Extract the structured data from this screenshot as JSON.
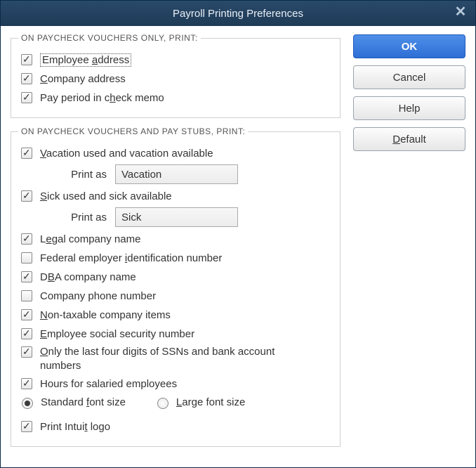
{
  "title": "Payroll Printing Preferences",
  "group1": {
    "legend": "ON PAYCHECK VOUCHERS ONLY, PRINT:",
    "emp_addr": {
      "label_pre": "Employee ",
      "u": "a",
      "label_post": "ddress",
      "checked": true
    },
    "comp_addr": {
      "u": "C",
      "label_post": "ompany address",
      "checked": true
    },
    "payperiod": {
      "label_pre": "Pay period in c",
      "u": "h",
      "label_post": "eck memo",
      "checked": true
    }
  },
  "group2": {
    "legend": "ON PAYCHECK VOUCHERS AND PAY STUBS, PRINT:",
    "vacation": {
      "u": "V",
      "label_post": "acation used and vacation available",
      "checked": true
    },
    "vac_printas": "Print as",
    "vac_value": "Vacation",
    "sick": {
      "u": "S",
      "label_post": "ick used and sick available",
      "checked": true
    },
    "sick_printas": "Print as",
    "sick_value": "Sick",
    "legal": {
      "label_pre": "L",
      "u": "e",
      "label_post": "gal company name",
      "checked": true
    },
    "fein": {
      "label_pre": "Federal employer ",
      "u": "i",
      "label_post": "dentification number",
      "checked": false
    },
    "dba": {
      "label_pre": "D",
      "u": "B",
      "label_post": "A company name",
      "checked": true
    },
    "phone": {
      "label_pre": "Company phone number",
      "checked": false,
      "no_u": true
    },
    "nontax": {
      "u": "N",
      "label_post": "on-taxable company items",
      "checked": true
    },
    "ssn": {
      "u": "E",
      "label_post": "mployee social security number",
      "checked": true
    },
    "last4": {
      "u": "O",
      "label_post": "nly the last four digits of SSNs and bank account numbers",
      "checked": true
    },
    "hours": {
      "label_pre": "Hours for salaried employees",
      "checked": true,
      "no_u": true
    },
    "font_std": {
      "label_pre": "Standard ",
      "u": "f",
      "label_post": "ont size",
      "checked": true
    },
    "font_lg": {
      "u": "L",
      "label_post": "arge font size",
      "checked": false
    },
    "logo": {
      "label_pre": "Print Intui",
      "u": "t",
      "label_post": " logo",
      "checked": true
    }
  },
  "buttons": {
    "ok": "OK",
    "cancel": "Cancel",
    "help": "Help",
    "default_pre": "",
    "default_u": "D",
    "default_post": "efault"
  }
}
